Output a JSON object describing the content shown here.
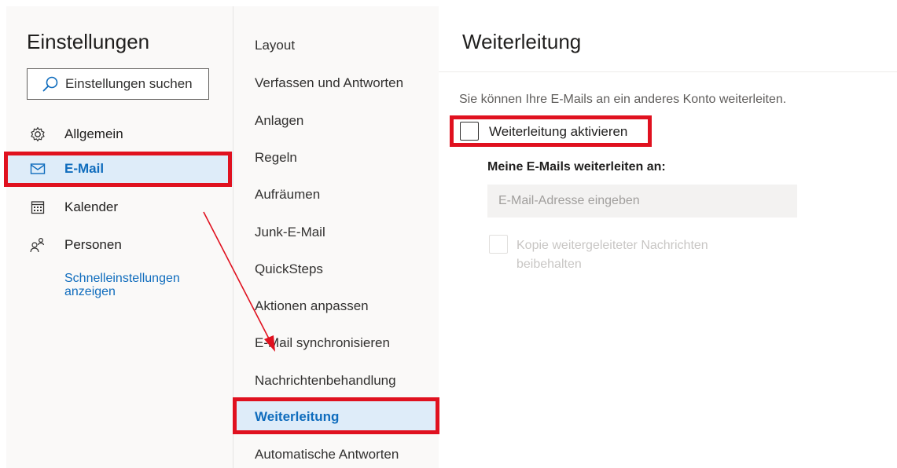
{
  "left": {
    "title": "Einstellungen",
    "search_placeholder": "Einstellungen suchen",
    "nav": [
      {
        "label": "Allgemein",
        "icon": "gear-icon"
      },
      {
        "label": "E-Mail",
        "icon": "mail-icon",
        "selected": true
      },
      {
        "label": "Kalender",
        "icon": "calendar-icon"
      },
      {
        "label": "Personen",
        "icon": "people-icon"
      }
    ],
    "quick_settings_line1": "Schnelleinstellungen",
    "quick_settings_line2": "anzeigen"
  },
  "middle": {
    "items": [
      "Layout",
      "Verfassen und Antworten",
      "Anlagen",
      "Regeln",
      "Aufräumen",
      "Junk-E-Mail",
      "QuickSteps",
      "Aktionen anpassen",
      "E-Mail synchronisieren",
      "Nachrichtenbehandlung",
      "Weiterleitung",
      "Automatische Antworten"
    ],
    "selected": "Weiterleitung"
  },
  "right": {
    "title": "Weiterleitung",
    "description": "Sie können Ihre E-Mails an ein anderes Konto weiterleiten.",
    "enable_checkbox_label": "Weiterleitung aktivieren",
    "enable_checked": false,
    "forward_to_label": "Meine E-Mails weiterleiten an:",
    "email_placeholder": "E-Mail-Adresse eingeben",
    "keep_copy_label": "Kopie weitergeleiteter Nachrichten beibehalten",
    "keep_copy_checked": false
  },
  "colors": {
    "accent": "#0f6cbd",
    "selected_bg": "#deecf9",
    "annotation_red": "#e0111f"
  }
}
